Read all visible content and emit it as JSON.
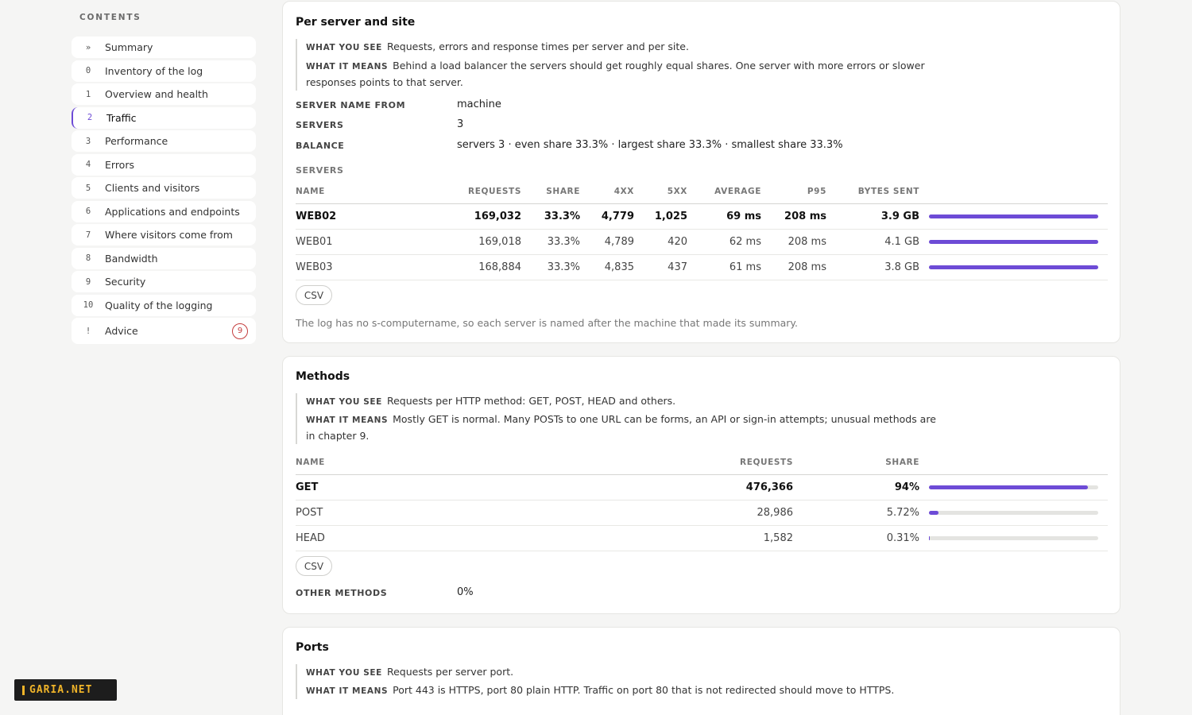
{
  "sidebar": {
    "heading": "CONTENTS",
    "items": [
      {
        "num": "»",
        "label": "Summary"
      },
      {
        "num": "0",
        "label": "Inventory of the log"
      },
      {
        "num": "1",
        "label": "Overview and health"
      },
      {
        "num": "2",
        "label": "Traffic",
        "active": true
      },
      {
        "num": "3",
        "label": "Performance"
      },
      {
        "num": "4",
        "label": "Errors"
      },
      {
        "num": "5",
        "label": "Clients and visitors"
      },
      {
        "num": "6",
        "label": "Applications and endpoints"
      },
      {
        "num": "7",
        "label": "Where visitors come from"
      },
      {
        "num": "8",
        "label": "Bandwidth"
      },
      {
        "num": "9",
        "label": "Security"
      },
      {
        "num": "10",
        "label": "Quality of the logging"
      }
    ],
    "advice": {
      "num": "!",
      "label": "Advice",
      "badge": "9"
    }
  },
  "brand": {
    "text": "GARIA.NET"
  },
  "per_server": {
    "title": "Per server and site",
    "what_you_see_key": "WHAT YOU SEE",
    "what_you_see": "Requests, errors and response times per server and per site.",
    "what_it_means_key": "WHAT IT MEANS",
    "what_it_means": "Behind a load balancer the servers should get roughly equal shares. One server with more errors or slower responses points to that server.",
    "kv": [
      {
        "key": "SERVER NAME FROM",
        "value": "machine"
      },
      {
        "key": "SERVERS",
        "value": "3"
      },
      {
        "key": "BALANCE",
        "value": "servers 3 · even share 33.3% · largest share 33.3% · smallest share 33.3%"
      }
    ],
    "table_heading": "SERVERS",
    "columns": [
      "NAME",
      "REQUESTS",
      "SHARE",
      "4XX",
      "5XX",
      "AVERAGE",
      "P95",
      "BYTES SENT"
    ],
    "rows": [
      {
        "name": "WEB02",
        "requests": "169,032",
        "share": "33.3%",
        "c4xx": "4,779",
        "c5xx": "1,025",
        "average": "69 ms",
        "p95": "208 ms",
        "bytes": "3.9 GB",
        "bar": 1.0
      },
      {
        "name": "WEB01",
        "requests": "169,018",
        "share": "33.3%",
        "c4xx": "4,789",
        "c5xx": "420",
        "average": "62 ms",
        "p95": "208 ms",
        "bytes": "4.1 GB",
        "bar": 1.0
      },
      {
        "name": "WEB03",
        "requests": "168,884",
        "share": "33.3%",
        "c4xx": "4,835",
        "c5xx": "437",
        "average": "61 ms",
        "p95": "208 ms",
        "bytes": "3.8 GB",
        "bar": 1.0
      }
    ],
    "csv_label": "CSV",
    "note": "The log has no s-computername, so each server is named after the machine that made its summary."
  },
  "methods": {
    "title": "Methods",
    "what_you_see_key": "WHAT YOU SEE",
    "what_you_see": "Requests per HTTP method: GET, POST, HEAD and others.",
    "what_it_means_key": "WHAT IT MEANS",
    "what_it_means": "Mostly GET is normal. Many POSTs to one URL can be forms, an API or sign-in attempts; unusual methods are in chapter 9.",
    "columns": [
      "NAME",
      "REQUESTS",
      "SHARE"
    ],
    "rows": [
      {
        "name": "GET",
        "requests": "476,366",
        "share": "94%",
        "bar": 0.94
      },
      {
        "name": "POST",
        "requests": "28,986",
        "share": "5.72%",
        "bar": 0.0572
      },
      {
        "name": "HEAD",
        "requests": "1,582",
        "share": "0.31%",
        "bar": 0.0031
      }
    ],
    "csv_label": "CSV",
    "other_key": "OTHER METHODS",
    "other_value": "0%"
  },
  "ports": {
    "title": "Ports",
    "what_you_see_key": "WHAT YOU SEE",
    "what_you_see": "Requests per server port.",
    "what_it_means_key": "WHAT IT MEANS",
    "what_it_means": "Port 443 is HTTPS, port 80 plain HTTP. Traffic on port 80 that is not redirected should move to HTTPS."
  },
  "colors": {
    "accent": "#6d4bd6",
    "badge": "#c43d3d",
    "brand": "#f0b429"
  }
}
